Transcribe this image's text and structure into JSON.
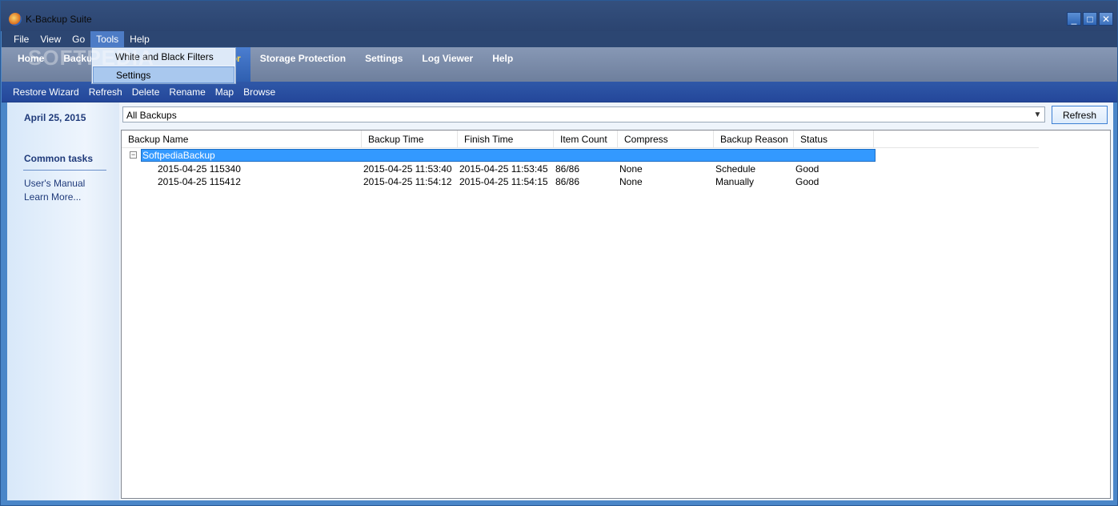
{
  "window": {
    "title": "K-Backup Suite",
    "watermark": "SOFTPEDIA",
    "controls": {
      "minimize": "_",
      "maximize": "□",
      "close": "✕"
    }
  },
  "menubar": {
    "items": [
      "File",
      "View",
      "Go",
      "Tools",
      "Help"
    ],
    "active": "Tools",
    "tools_menu": [
      "White and Black Filters",
      "Settings"
    ]
  },
  "nav": {
    "tabs": [
      "Home",
      "Backup",
      "Monitor",
      "Storage Protection",
      "Settings",
      "Log Viewer",
      "Help"
    ],
    "active": "Monitor"
  },
  "toolbar": {
    "items": [
      "Restore Wizard",
      "Refresh",
      "Delete",
      "Rename",
      "Map",
      "Browse"
    ]
  },
  "sidebar": {
    "date": "April 25, 2015",
    "heading": "Common tasks",
    "links": [
      "User's Manual",
      "Learn More..."
    ]
  },
  "main": {
    "filter_value": "All Backups",
    "refresh_label": "Refresh",
    "columns": [
      "Backup Name",
      "Backup Time",
      "Finish Time",
      "Item Count",
      "Compress",
      "Backup Reason",
      "Status"
    ],
    "group": {
      "name": "SoftpediaBackup",
      "expander": "−"
    },
    "rows": [
      [
        "2015-04-25 115340",
        "2015-04-25 11:53:40",
        "2015-04-25 11:53:45",
        "86/86",
        "None",
        "Schedule",
        "Good"
      ],
      [
        "2015-04-25 115412",
        "2015-04-25 11:54:12",
        "2015-04-25 11:54:15",
        "86/86",
        "None",
        "Manually",
        "Good"
      ]
    ]
  }
}
